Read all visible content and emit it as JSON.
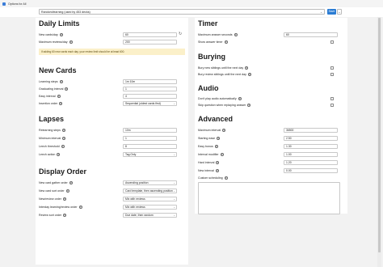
{
  "window": {
    "title": "Options for All"
  },
  "toolbar": {
    "preset_value": "Random/learning (used by 453 decks)",
    "save_label": "Save",
    "more_label": "⌄"
  },
  "daily_limits": {
    "title": "Daily Limits",
    "new_cards_label": "New cards/day",
    "new_cards_value": "60",
    "max_reviews_label": "Maximum reviews/day",
    "max_reviews_value": "200",
    "warning": "If adding 60 new cards each day, your review limit should be at least 600."
  },
  "new_cards": {
    "title": "New Cards",
    "learning_steps_label": "Learning steps",
    "learning_steps_value": "1m 10m",
    "graduating_interval_label": "Graduating interval",
    "graduating_interval_value": "1",
    "easy_interval_label": "Easy interval",
    "easy_interval_value": "4",
    "insertion_order_label": "Insertion order",
    "insertion_order_value": "Sequential (oldest cards first)"
  },
  "lapses": {
    "title": "Lapses",
    "relearning_steps_label": "Relearning steps",
    "relearning_steps_value": "10m",
    "minimum_interval_label": "Minimum interval",
    "minimum_interval_value": "1",
    "leech_threshold_label": "Leech threshold",
    "leech_threshold_value": "8",
    "leech_action_label": "Leech action",
    "leech_action_value": "Tag Only"
  },
  "display_order": {
    "title": "Display Order",
    "new_gather_label": "New card gather order",
    "new_gather_value": "Ascending position",
    "new_sort_label": "New card sort order",
    "new_sort_value": "Card template, then ascending position",
    "new_review_label": "New/review order",
    "new_review_value": "Mix with reviews",
    "interday_label": "Interday learning/review order",
    "interday_value": "Mix with reviews",
    "review_sort_label": "Review sort order",
    "review_sort_value": "Due date, then random"
  },
  "timer": {
    "title": "Timer",
    "max_answer_label": "Maximum answer seconds",
    "max_answer_value": "60",
    "show_timer_label": "Show answer timer"
  },
  "burying": {
    "title": "Burying",
    "bury_new_label": "Bury new siblings until the next day",
    "bury_review_label": "Bury review siblings until the next day"
  },
  "audio": {
    "title": "Audio",
    "dont_play_label": "Don't play audio automatically",
    "skip_question_label": "Skip question when replaying answer"
  },
  "advanced": {
    "title": "Advanced",
    "max_interval_label": "Maximum interval",
    "max_interval_value": "36500",
    "starting_ease_label": "Starting ease",
    "starting_ease_value": "2.50",
    "easy_bonus_label": "Easy bonus",
    "easy_bonus_value": "1.30",
    "interval_modifier_label": "Interval modifier",
    "interval_modifier_value": "1.00",
    "hard_interval_label": "Hard interval",
    "hard_interval_value": "1.20",
    "new_interval_label": "New interval",
    "new_interval_value": "0.00",
    "custom_scheduling_label": "Custom scheduling"
  },
  "icons": {
    "help": "?",
    "reset": "↻",
    "caret": "⌄"
  }
}
